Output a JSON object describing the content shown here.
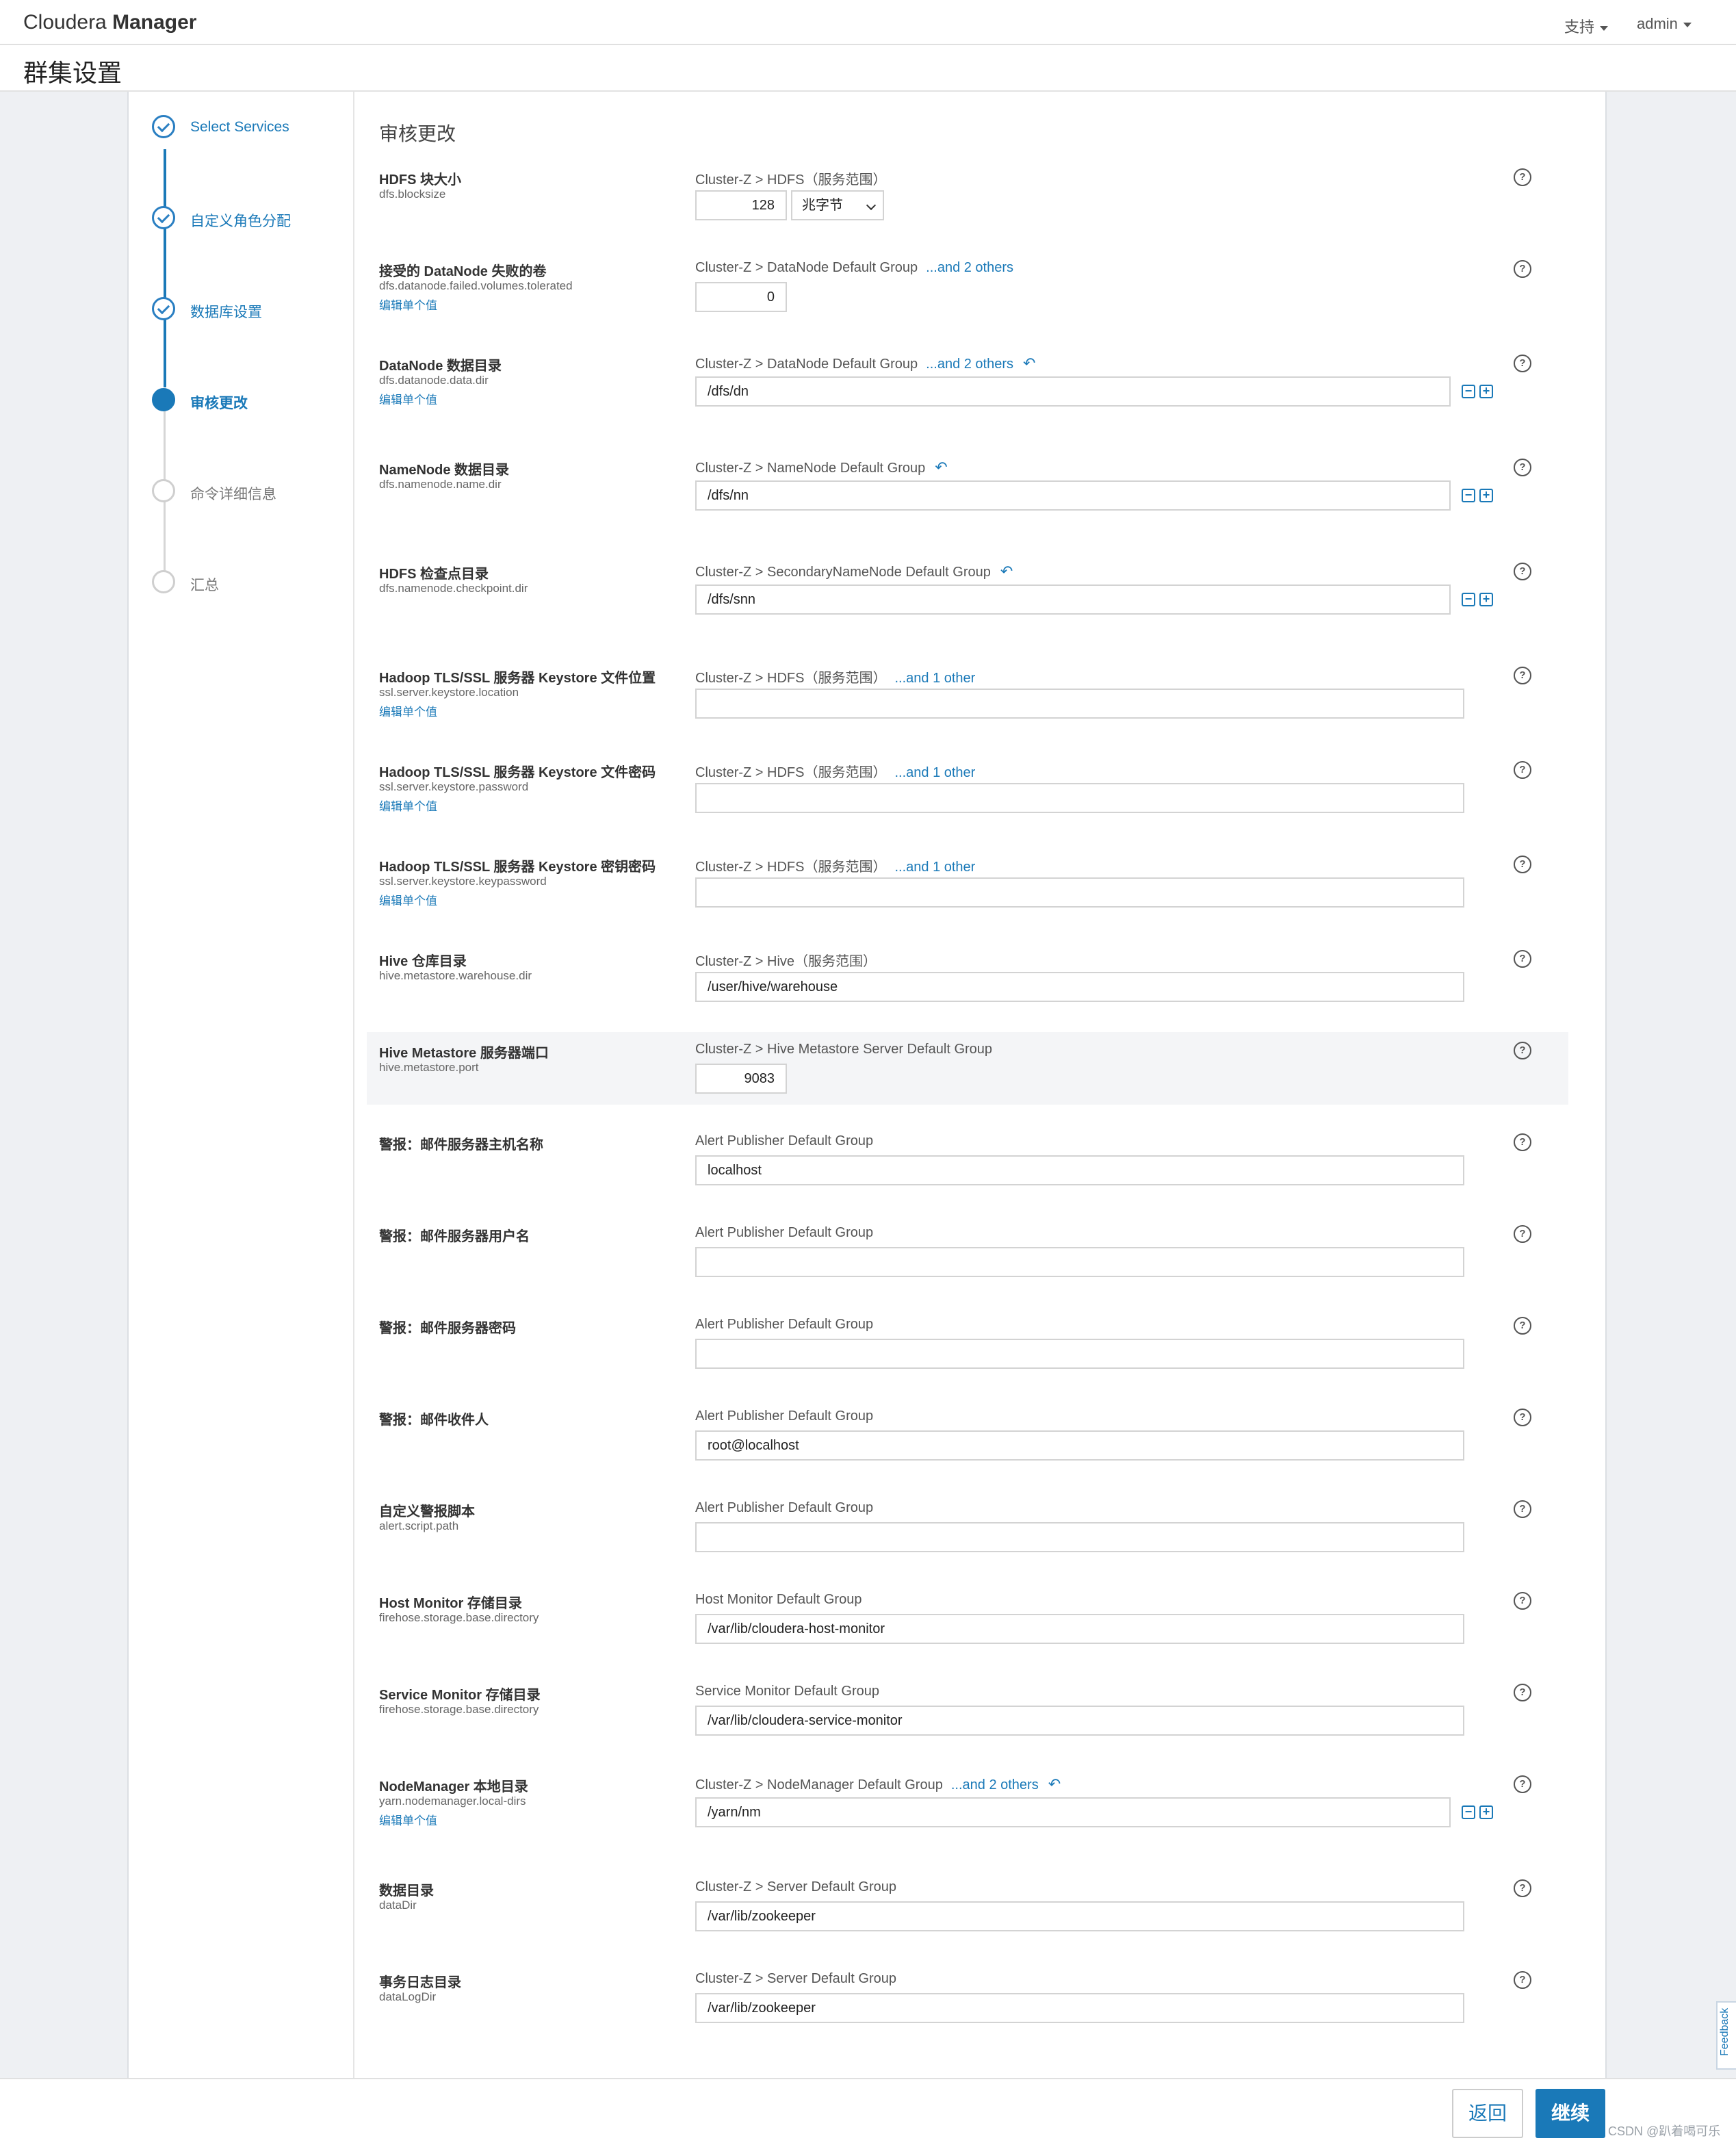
{
  "app": {
    "brand_light": "Cloudera",
    "brand_strong": "Manager"
  },
  "topnav": {
    "support": "支持",
    "user": "admin"
  },
  "page": {
    "title": "群集设置"
  },
  "wizard": {
    "steps": [
      {
        "label": "Select Services",
        "state": "done"
      },
      {
        "label": "自定义角色分配",
        "state": "done"
      },
      {
        "label": "数据库设置",
        "state": "done"
      },
      {
        "label": "审核更改",
        "state": "active"
      },
      {
        "label": "命令详细信息",
        "state": "todo"
      },
      {
        "label": "汇总",
        "state": "todo"
      }
    ]
  },
  "main": {
    "section_title": "审核更改",
    "edit_label": "编辑单个值",
    "undo_glyph": "↶",
    "help_glyph": "?",
    "minus_glyph": "−",
    "plus_glyph": "+",
    "params": [
      {
        "title": "HDFS 块大小",
        "key": "dfs.blocksize",
        "scope": "Cluster-Z > HDFS（服务范围）",
        "others": "",
        "value": "128",
        "unit": "兆字节"
      },
      {
        "title": "接受的 DataNode 失败的卷",
        "key": "dfs.datanode.failed.volumes.tolerated",
        "scope": "Cluster-Z > DataNode Default Group",
        "others": "...and 2 others",
        "value": "0"
      },
      {
        "title": "DataNode 数据目录",
        "key": "dfs.datanode.data.dir",
        "scope": "Cluster-Z > DataNode Default Group",
        "others": "...and 2 others",
        "value": "/dfs/dn"
      },
      {
        "title": "NameNode 数据目录",
        "key": "dfs.namenode.name.dir",
        "scope": "Cluster-Z > NameNode Default Group",
        "others": "",
        "value": "/dfs/nn"
      },
      {
        "title": "HDFS 检查点目录",
        "key": "dfs.namenode.checkpoint.dir",
        "scope": "Cluster-Z > SecondaryNameNode Default Group",
        "others": "",
        "value": "/dfs/snn"
      },
      {
        "title": "Hadoop TLS/SSL 服务器 Keystore 文件位置",
        "key": "ssl.server.keystore.location",
        "scope": "Cluster-Z > HDFS（服务范围）",
        "others": "...and 1 other",
        "value": ""
      },
      {
        "title": "Hadoop TLS/SSL 服务器 Keystore 文件密码",
        "key": "ssl.server.keystore.password",
        "scope": "Cluster-Z > HDFS（服务范围）",
        "others": "...and 1 other",
        "value": ""
      },
      {
        "title": "Hadoop TLS/SSL 服务器 Keystore 密钥密码",
        "key": "ssl.server.keystore.keypassword",
        "scope": "Cluster-Z > HDFS（服务范围）",
        "others": "...and 1 other",
        "value": ""
      },
      {
        "title": "Hive 仓库目录",
        "key": "hive.metastore.warehouse.dir",
        "scope": "Cluster-Z > Hive（服务范围）",
        "others": "",
        "value": "/user/hive/warehouse"
      },
      {
        "title": "Hive Metastore 服务器端口",
        "key": "hive.metastore.port",
        "scope": "Cluster-Z > Hive Metastore Server Default Group",
        "others": "",
        "value": "9083"
      },
      {
        "title": "警报：邮件服务器主机名称",
        "key": "",
        "scope": "Alert Publisher Default Group",
        "others": "",
        "value": "localhost"
      },
      {
        "title": "警报：邮件服务器用户名",
        "key": "",
        "scope": "Alert Publisher Default Group",
        "others": "",
        "value": ""
      },
      {
        "title": "警报：邮件服务器密码",
        "key": "",
        "scope": "Alert Publisher Default Group",
        "others": "",
        "value": ""
      },
      {
        "title": "警报：邮件收件人",
        "key": "",
        "scope": "Alert Publisher Default Group",
        "others": "",
        "value": "root@localhost"
      },
      {
        "title": "自定义警报脚本",
        "key": "alert.script.path",
        "scope": "Alert Publisher Default Group",
        "others": "",
        "value": ""
      },
      {
        "title": "Host Monitor 存储目录",
        "key": "firehose.storage.base.directory",
        "scope": "Host Monitor Default Group",
        "others": "",
        "value": "/var/lib/cloudera-host-monitor"
      },
      {
        "title": "Service Monitor 存储目录",
        "key": "firehose.storage.base.directory",
        "scope": "Service Monitor Default Group",
        "others": "",
        "value": "/var/lib/cloudera-service-monitor"
      },
      {
        "title": "NodeManager 本地目录",
        "key": "yarn.nodemanager.local-dirs",
        "scope": "Cluster-Z > NodeManager Default Group",
        "others": "...and 2 others",
        "value": "/yarn/nm"
      },
      {
        "title": "数据目录",
        "key": "dataDir",
        "scope": "Cluster-Z > Server Default Group",
        "others": "",
        "value": "/var/lib/zookeeper"
      },
      {
        "title": "事务日志目录",
        "key": "dataLogDir",
        "scope": "Cluster-Z > Server Default Group",
        "others": "",
        "value": "/var/lib/zookeeper"
      }
    ]
  },
  "footer": {
    "back": "返回",
    "next": "继续",
    "watermark": "CSDN @趴着喝可乐"
  },
  "feedback": "Feedback",
  "colors": {
    "accent": "#1a79b8",
    "side_bg": "#eef0f3",
    "highlight_row": "#f4f5f7"
  }
}
